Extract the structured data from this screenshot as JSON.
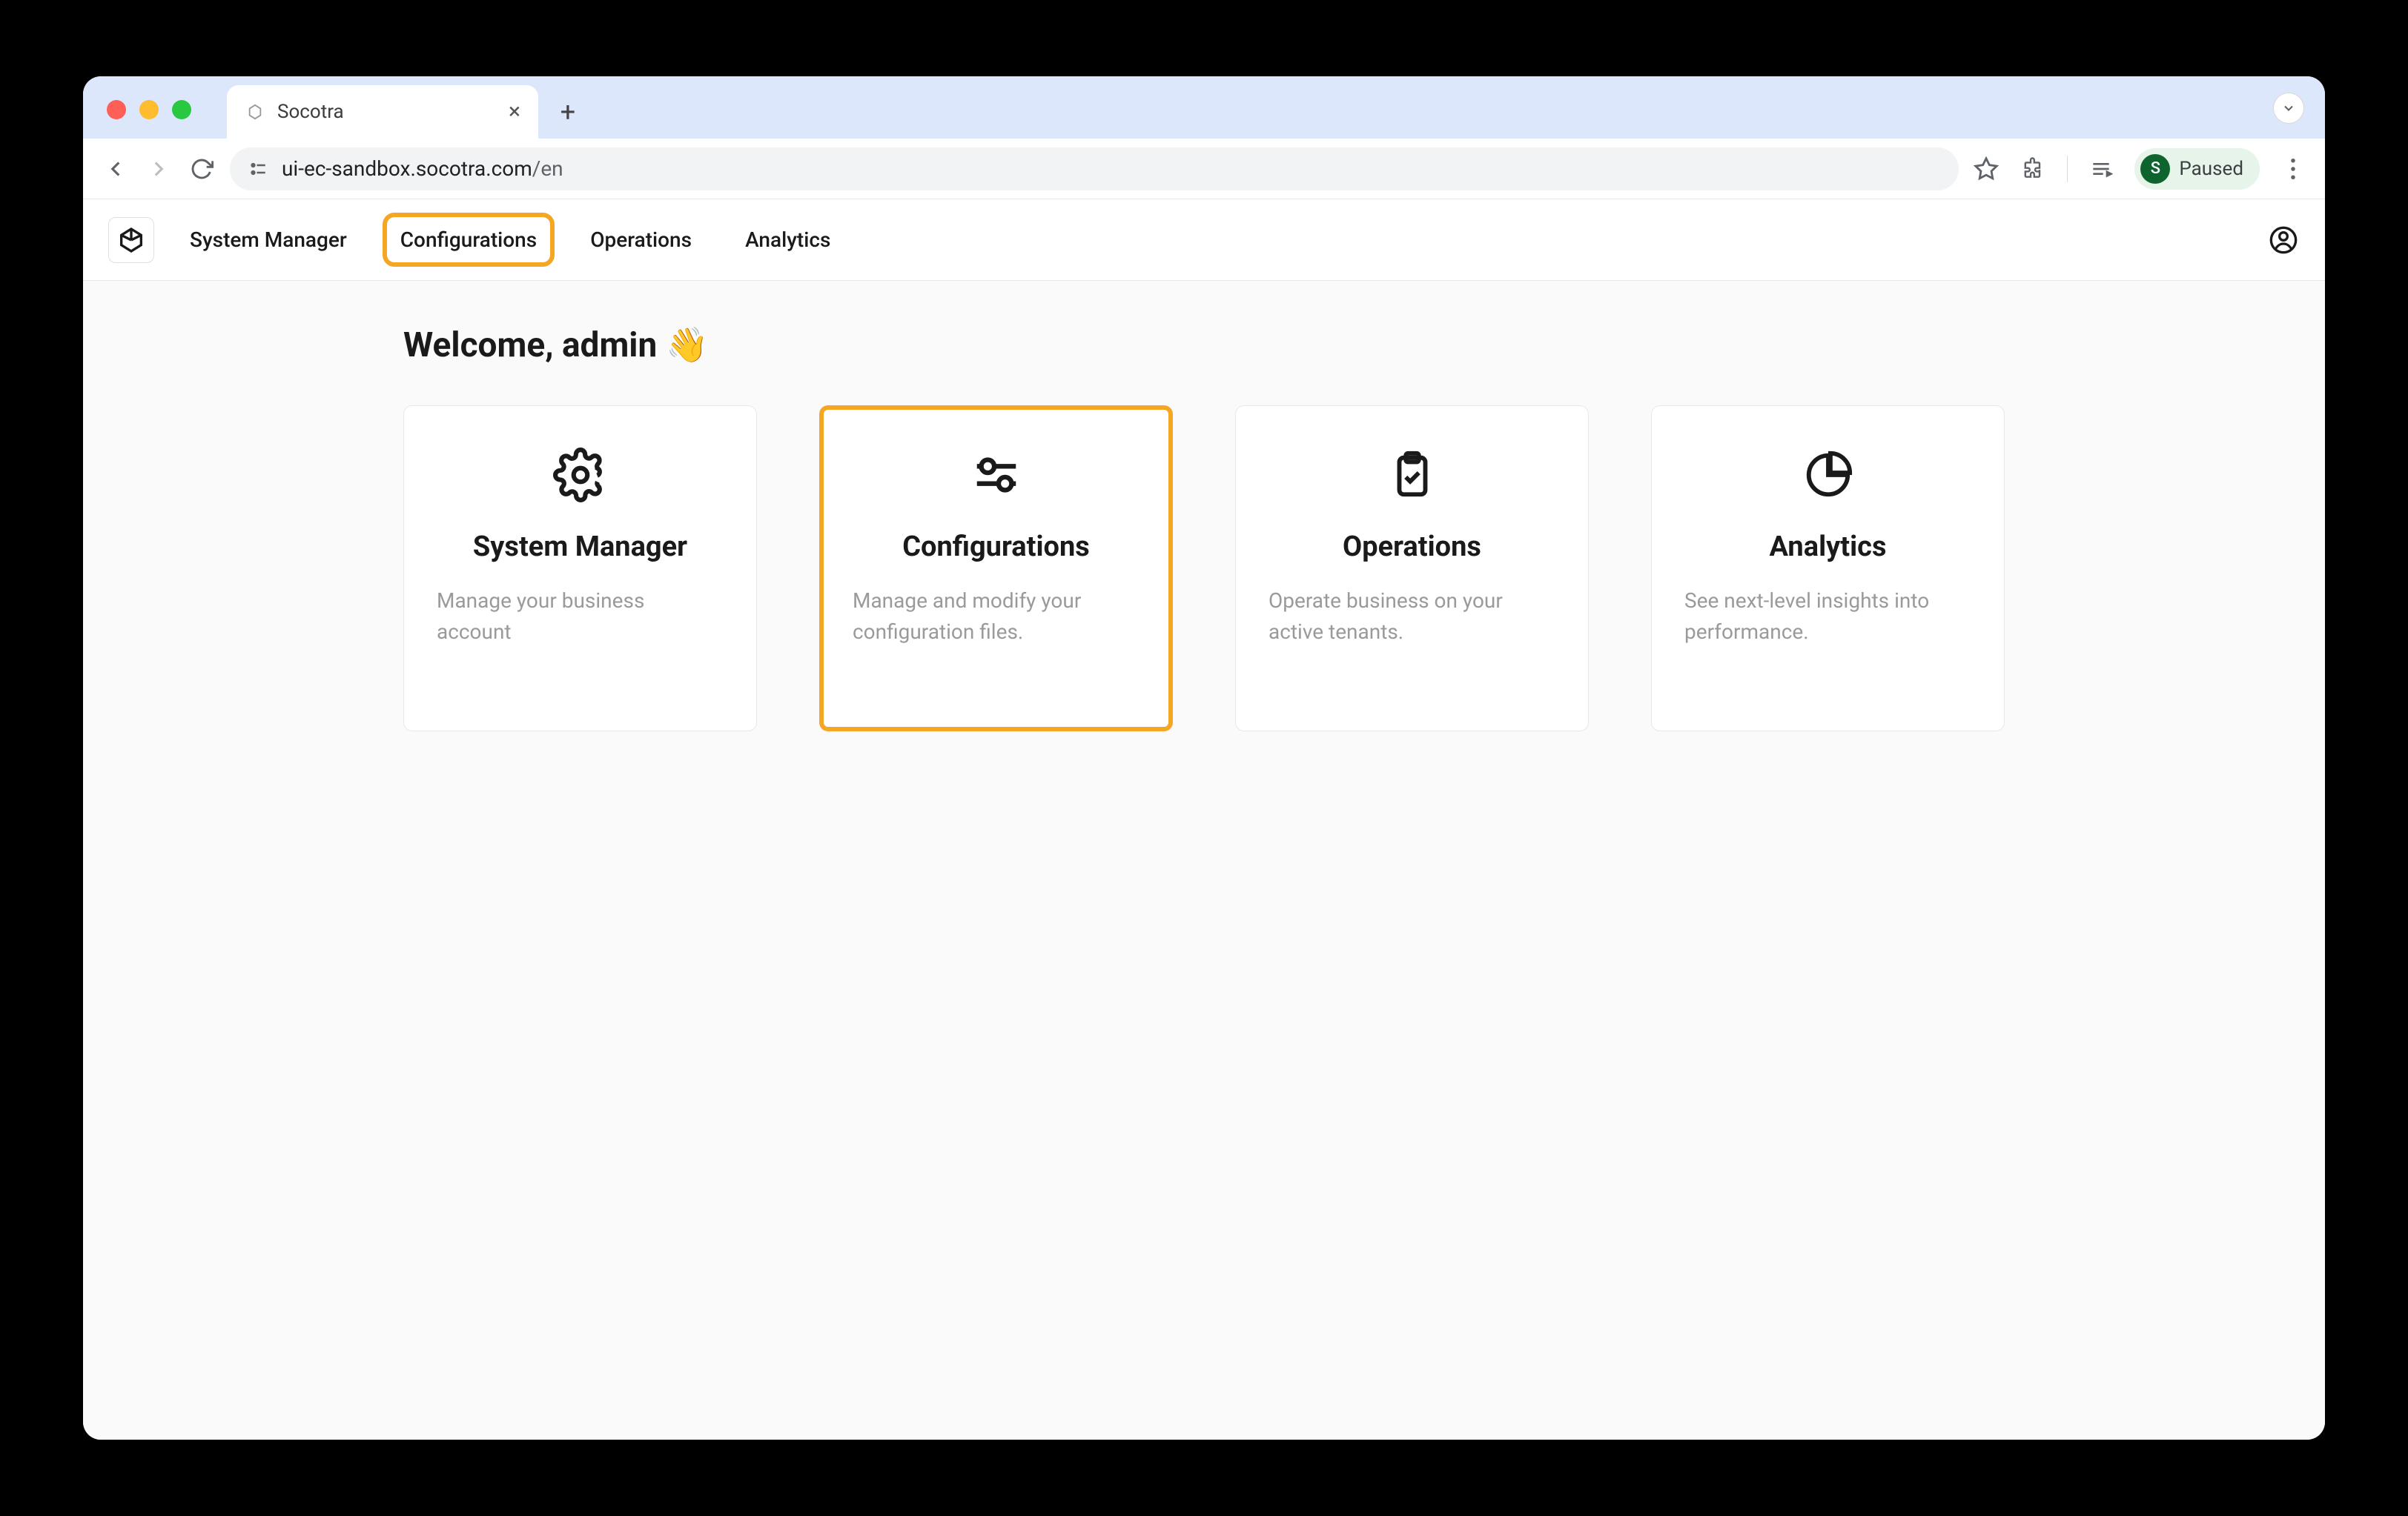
{
  "browser": {
    "tab_title": "Socotra",
    "url_host": "ui-ec-sandbox.socotra.com",
    "url_path": "/en",
    "profile_initial": "S",
    "profile_label": "Paused"
  },
  "nav": {
    "items": [
      {
        "label": "System Manager",
        "highlighted": false
      },
      {
        "label": "Configurations",
        "highlighted": true
      },
      {
        "label": "Operations",
        "highlighted": false
      },
      {
        "label": "Analytics",
        "highlighted": false
      }
    ]
  },
  "main": {
    "welcome_text": "Welcome, admin",
    "welcome_emoji": "👋",
    "cards": [
      {
        "icon": "gear-icon",
        "title": "System Manager",
        "desc": "Manage your business account",
        "highlighted": false
      },
      {
        "icon": "sliders-icon",
        "title": "Configurations",
        "desc": "Manage and modify your configuration files.",
        "highlighted": true
      },
      {
        "icon": "clipboard-icon",
        "title": "Operations",
        "desc": "Operate business on your active tenants.",
        "highlighted": false
      },
      {
        "icon": "piechart-icon",
        "title": "Analytics",
        "desc": "See next-level insights into performance.",
        "highlighted": false
      }
    ]
  }
}
